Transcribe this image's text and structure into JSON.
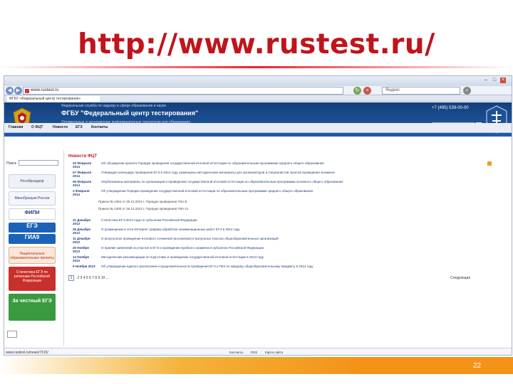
{
  "slide": {
    "title": "http://www.rustest.ru/",
    "page_number": "22"
  },
  "browser": {
    "url": "www.rustest.ru",
    "search_text": "Яндекс",
    "tab_title": "ФГБУ «Федеральный центр тестирования»",
    "status_url": "www.rustest.ru/news/7315/"
  },
  "site": {
    "header_line1": "Федеральная служба по надзору в сфере образования и науки",
    "title": "ФГБУ \"Федеральный центр тестирования\"",
    "header_line2": "Оптимальные и экономичные информационные технологии для образования",
    "phone": "+7 (495) 539-00-00",
    "menu": [
      "Главная",
      "О ФЦТ",
      "Новости",
      "ЕГЭ",
      "Контакты"
    ]
  },
  "sidebar": {
    "search_label": "Поиск",
    "banners": [
      {
        "name": "rosobrnadzor",
        "text": "Рособрнадзор"
      },
      {
        "name": "minobrnauki",
        "text": "Минобрнауки России"
      },
      {
        "name": "fipi",
        "text": "ФИПИ"
      },
      {
        "name": "ege",
        "text": "ЕГЭ"
      },
      {
        "name": "gia9",
        "text": "ГИА9"
      },
      {
        "name": "rcoi",
        "text": "Национальные образовательные проекты"
      },
      {
        "name": "stat-ege",
        "text": "Статистика ЕГЭ по регионам Российской Федерации"
      },
      {
        "name": "honest-ege",
        "text": "За честный ЕГЭ"
      }
    ]
  },
  "news": {
    "heading": "Новости ФЦТ",
    "items": [
      {
        "date": "20 Февраля 2014",
        "text": "Об обсуждении проекта Порядка проведения государственной итоговой аттестации по образовательным программам среднего общего образования"
      },
      {
        "date": "07 Февраля 2014",
        "text": "Утвержден календарь проведения ЕГЭ в 2014 году, размещены методические материалы для организаторов и специалистов пунктов проведения экзамена"
      },
      {
        "date": "06 Февраля 2014",
        "text": "Опубликованы материалы по организации и проведению государственной итоговой аттестации по образовательным программам основного общего образования"
      },
      {
        "date": "3 Февраля 2014",
        "text": "Об утверждении Порядка проведения государственной итоговой аттестации по образовательным программам среднего общего образования"
      },
      {
        "date": "31 Декабря 2013",
        "text": "Статистика ЕГЭ 2013 года по субъектам Российской Федерации"
      },
      {
        "date": "26 Декабря 2013",
        "text": "О размещении в сети Интернет графика обработки экзаменационных работ ЕГЭ в 2014 году"
      },
      {
        "date": "11 Декабря 2013",
        "text": "О результатах проведения итогового сочинения (изложения) в выпускных классах общеобразовательных организаций"
      },
      {
        "date": "20 Ноября 2013",
        "text": "О приеме заявлений на участие в ЕГЭ и проведении пробного экзамена в субъектах Российской Федерации"
      },
      {
        "date": "14 Ноября 2013",
        "text": "Методические рекомендации по подготовке и проведению государственной итоговой аттестации в 2014 году"
      },
      {
        "date": "5 Ноября 2013",
        "text": "Об утверждении единого расписания и продолжительности проведения ЕГЭ и ГВЭ по каждому общеобразовательному предмету в 2014 году"
      }
    ],
    "sub_lines": [
      "Приказ № 1394 от 25.12.2013 г. Порядок проведения ГИА-9",
      "Приказ № 1400 от 26.12.2013 г. Порядок проведения ГИА-11"
    ],
    "pager_current": "1",
    "pager_pages": "2 3 4 5 6 7 8 9 10 ...",
    "pager_next": "Следующая"
  },
  "footer": {
    "links": [
      "Контакты",
      "RSS",
      "Карта сайта"
    ]
  }
}
